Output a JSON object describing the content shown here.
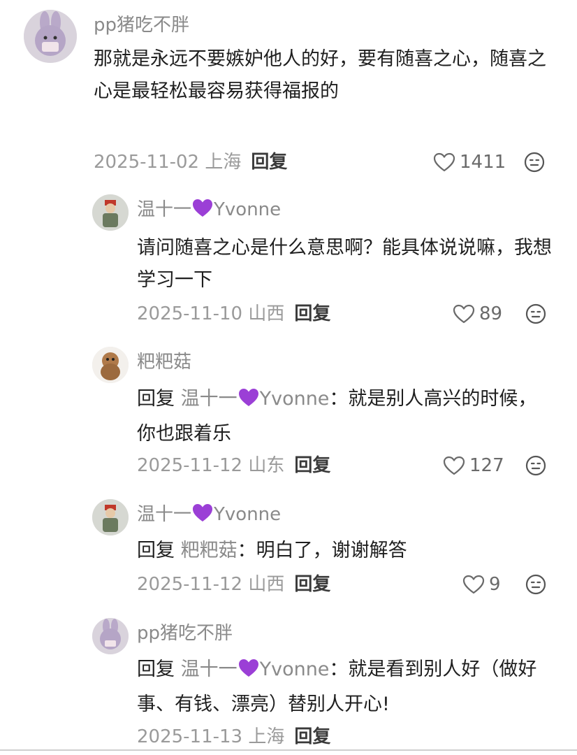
{
  "comments": [
    {
      "name": "pp猪吃不胖",
      "text": "那就是永远不要嫉妒他人的好，要有随喜之心，随喜之心是最轻松最容易获得福报的",
      "date": "2025-11-02 上海",
      "reply_label": "回复",
      "likes": "1411"
    },
    {
      "name_prefix": "温十一",
      "name_suffix": "Yvonne",
      "text": "请问随喜之心是什么意思啊？能具体说说嘛，我想学习一下",
      "date": "2025-11-10 山西",
      "reply_label": "回复",
      "likes": "89"
    },
    {
      "name": "粑粑菇",
      "reply_word": "回复",
      "target_prefix": "温十一",
      "target_suffix": "Yvonne",
      "text": "：就是别人高兴的时候，你也跟着乐",
      "date": "2025-11-12 山东",
      "reply_label": "回复",
      "likes": "127"
    },
    {
      "name_prefix": "温十一",
      "name_suffix": "Yvonne",
      "reply_word": "回复",
      "target": "粑粑菇",
      "text": "：明白了，谢谢解答",
      "date": "2025-11-12 山西",
      "reply_label": "回复",
      "likes": "9"
    },
    {
      "name": "pp猪吃不胖",
      "reply_word": "回复",
      "target_prefix": "温十一",
      "target_suffix": "Yvonne",
      "text": "：就是看到别人好（做好事、有钱、漂亮）替别人开心!",
      "date": "2025-11-13 上海",
      "reply_label": "回复"
    }
  ],
  "icons": {
    "like": "heart-outline-icon",
    "react": "meh-face-icon",
    "name_emoji": "purple-heart-emoji"
  },
  "colors": {
    "purple_heart": "#9b3fd6",
    "meta_gray": "#9a9a9a"
  }
}
